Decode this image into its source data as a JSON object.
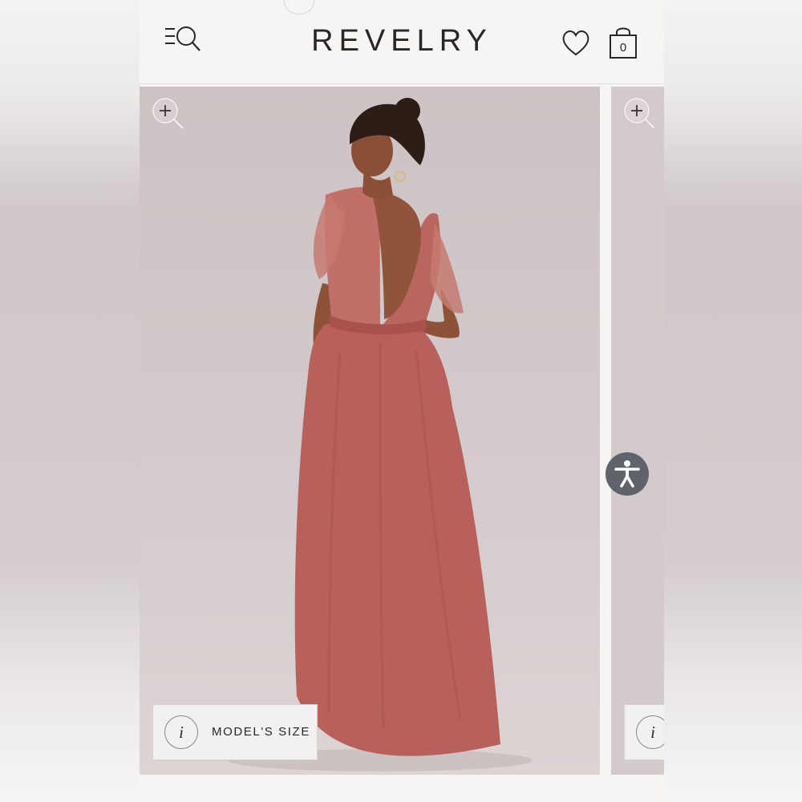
{
  "header": {
    "brand": "REVELRY",
    "menu_icon": "menu-search-icon",
    "wishlist_icon": "heart-icon",
    "bag_icon": "shopping-bag-icon",
    "bag_count": "0"
  },
  "gallery": {
    "zoom_icon": "zoom-in-icon",
    "model_size_label": "MODEL'S SIZE",
    "info_glyph": "i",
    "dress_color": "#b8605b"
  },
  "accessibility": {
    "icon": "accessibility-person-icon",
    "color": "#5f636b"
  }
}
